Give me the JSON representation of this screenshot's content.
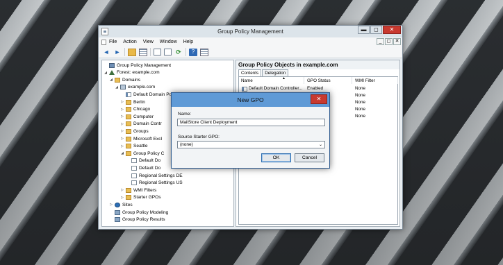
{
  "window": {
    "title": "Group Policy Management"
  },
  "menu": [
    "File",
    "Action",
    "View",
    "Window",
    "Help"
  ],
  "window_buttons": {
    "minimize": "▬",
    "maximize": "◻",
    "close": "✕"
  },
  "menubar_buttons": {
    "minimize": "_",
    "restore": "◻",
    "close": "✕"
  },
  "toolbar": {
    "back": "◄",
    "forward": "►",
    "help": "?"
  },
  "tree": [
    {
      "label": "Group Policy Management",
      "icon": "gpm",
      "expander": ""
    },
    {
      "label": "Forest: example.com",
      "icon": "forest",
      "expander": "◢"
    },
    {
      "label": "Domains",
      "icon": "folder",
      "expander": "◢"
    },
    {
      "label": "example.com",
      "icon": "domain",
      "expander": "◢"
    },
    {
      "label": "Default Domain Policy",
      "icon": "gpo",
      "expander": ""
    },
    {
      "label": "Berlin",
      "icon": "ou",
      "expander": "▷"
    },
    {
      "label": "Chicago",
      "icon": "ou",
      "expander": "▷"
    },
    {
      "label": "Computer",
      "icon": "ou",
      "expander": "▷"
    },
    {
      "label": "Domain Contr",
      "icon": "ou",
      "expander": "▷"
    },
    {
      "label": "Groups",
      "icon": "ou",
      "expander": "▷"
    },
    {
      "label": "Microsoft Excl",
      "icon": "ou",
      "expander": "▷"
    },
    {
      "label": "Seattle",
      "icon": "ou",
      "expander": "▷"
    },
    {
      "label": "Group Policy C",
      "icon": "folder",
      "expander": "◢"
    },
    {
      "label": "Default Do",
      "icon": "doc",
      "expander": ""
    },
    {
      "label": "Default Do",
      "icon": "doc",
      "expander": ""
    },
    {
      "label": "Regional Settings DE",
      "icon": "doc",
      "expander": ""
    },
    {
      "label": "Regional Settings US",
      "icon": "doc",
      "expander": ""
    },
    {
      "label": "WMI Filters",
      "icon": "folder",
      "expander": "▷"
    },
    {
      "label": "Starter GPOs",
      "icon": "folder",
      "expander": "▷"
    },
    {
      "label": "Sites",
      "icon": "sites",
      "expander": "▷"
    },
    {
      "label": "Group Policy Modeling",
      "icon": "model",
      "expander": ""
    },
    {
      "label": "Group Policy Results",
      "icon": "model",
      "expander": ""
    }
  ],
  "right": {
    "header": "Group Policy Objects in example.com",
    "tabs": [
      "Contents",
      "Delegation"
    ],
    "columns": [
      "Name",
      "GPO Status",
      "WMI Filter"
    ],
    "sort_indicator": "▲",
    "rows": [
      {
        "name": "Default Domain Controller...",
        "status": "Enabled",
        "wmi": "None"
      },
      {
        "name": "",
        "status": "",
        "wmi": "None"
      },
      {
        "name": "",
        "status": "",
        "wmi": "None"
      },
      {
        "name": "",
        "status": "",
        "wmi": "None"
      },
      {
        "name": "",
        "status": "",
        "wmi": "None"
      }
    ]
  },
  "dialog": {
    "title": "New GPO",
    "close": "✕",
    "name_label": "Name:",
    "name_value": "MailStore Client Deployment",
    "starter_label": "Source Starter GPO:",
    "starter_value": "(none)",
    "select_arrow": "⌄",
    "ok": "OK",
    "cancel": "Cancel"
  }
}
